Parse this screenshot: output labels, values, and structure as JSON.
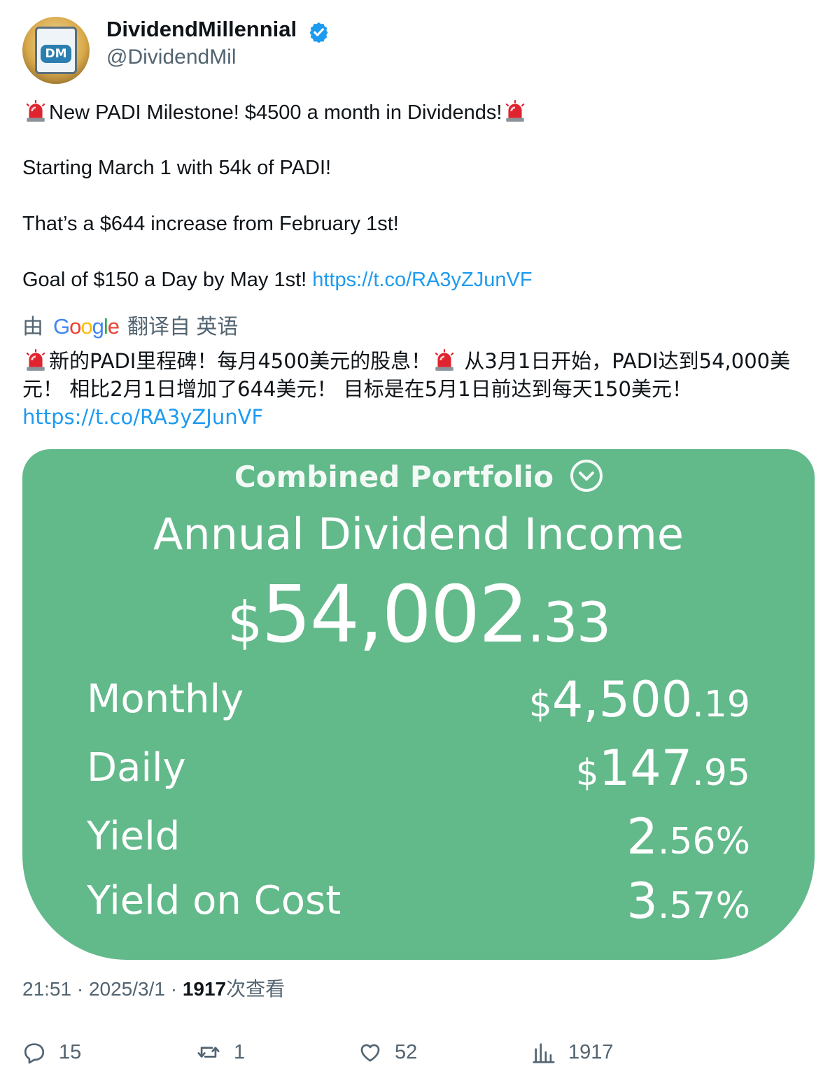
{
  "author": {
    "name": "DividendMillennial",
    "handle": "@DividendMil",
    "avatar_text": "DM",
    "verified_color": "#1d9bf0"
  },
  "tweet": {
    "line1": "New PADI Milestone!  $4500 a month in Dividends!",
    "line2": "Starting March 1 with 54k of PADI!",
    "line3": "That’s a $644 increase from February 1st!",
    "line4": "Goal of $150 a Day by May 1st! ",
    "link": "https://t.co/RA3yZJunVF"
  },
  "translation": {
    "prefix": "由",
    "google": "Google",
    "suffix": "翻译自 英语",
    "part1": "新的PADI里程碑！每月4500美元的股息！",
    "part2": " 从3月1日开始，PADI达到54,000美元！ 相比2月1日增加了644美元！ 目标是在5月1日前达到每天150美元！",
    "link": "https://t.co/RA3yZJunVF"
  },
  "card": {
    "background": "#62b98a",
    "title": "Combined Portfolio",
    "subtitle": "Annual Dividend Income",
    "annual": {
      "currency": "$",
      "main": "54,002",
      "cents": ".33"
    },
    "rows": [
      {
        "label": "Monthly",
        "currency": "$",
        "main": "4,500",
        "cents": ".19"
      },
      {
        "label": "Daily",
        "currency": "$",
        "main": "147",
        "cents": ".95"
      },
      {
        "label": "Yield",
        "currency": "",
        "main": "2",
        "cents": ".56%"
      },
      {
        "label": "Yield on Cost",
        "currency": "",
        "main": "3",
        "cents": ".57%"
      }
    ]
  },
  "meta": {
    "time": "21:51 · 2025/3/1 · ",
    "views": "1917",
    "views_label": "次查看"
  },
  "actions": {
    "replies": "15",
    "retweets": "1",
    "likes": "52",
    "views": "1917"
  }
}
